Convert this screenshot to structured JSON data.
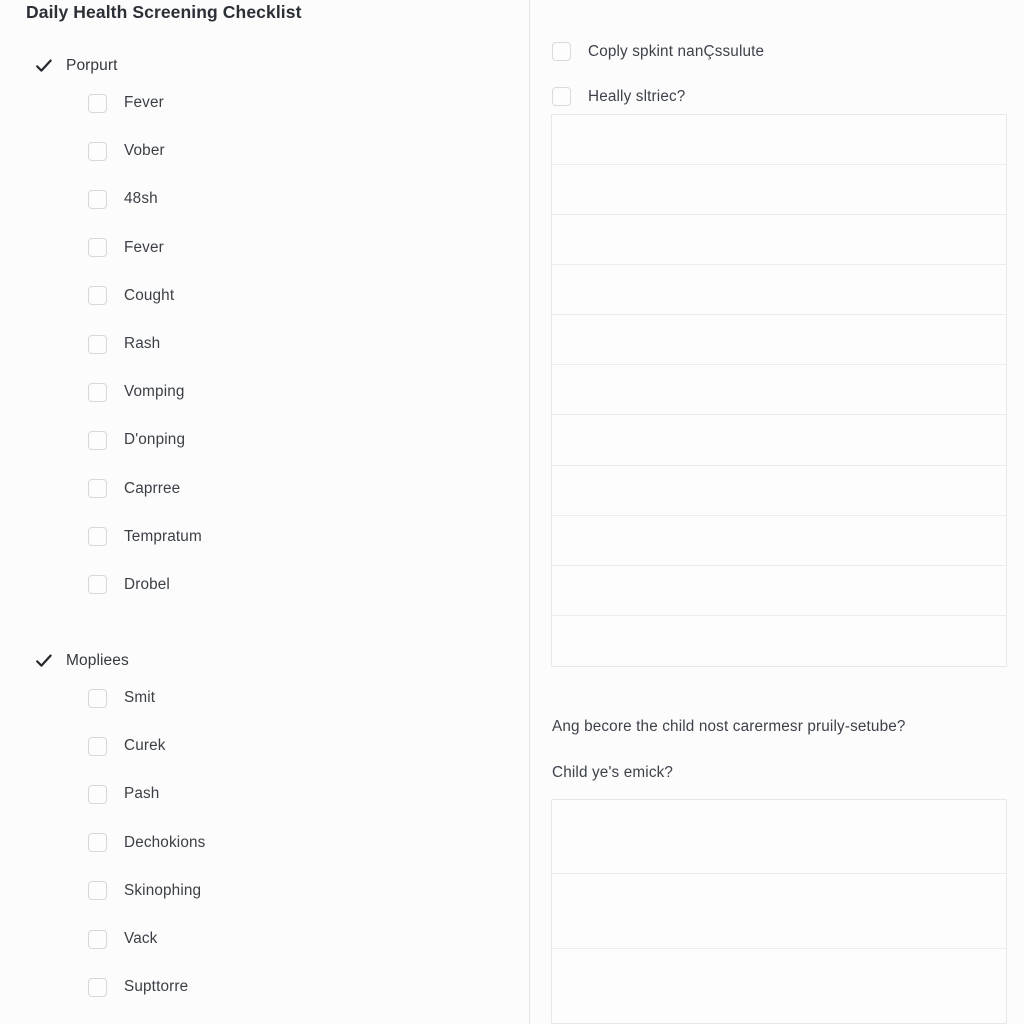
{
  "page": {
    "title": "Daily Health Screening Checklist",
    "background_color": "#fcfcfc",
    "text_color": "#3a3f46",
    "divider_color": "#e3e4e6"
  },
  "left_panel": {
    "groups": [
      {
        "label": "Porpurt",
        "checked": true,
        "check_icon": "checkmark-icon",
        "items": [
          {
            "label": "Fever",
            "checked": false
          },
          {
            "label": "Vober",
            "checked": false
          },
          {
            "label": "48sh",
            "checked": false
          },
          {
            "label": "Fever",
            "checked": false
          },
          {
            "label": "Cought",
            "checked": false
          },
          {
            "label": "Rash",
            "checked": false
          },
          {
            "label": "Vomping",
            "checked": false
          },
          {
            "label": "D'onping",
            "checked": false
          },
          {
            "label": "Caprree",
            "checked": false
          },
          {
            "label": "Tempratum",
            "checked": false
          },
          {
            "label": "Drobel",
            "checked": false
          }
        ]
      },
      {
        "label": "Mopliees",
        "checked": true,
        "check_icon": "checkmark-icon",
        "items": [
          {
            "label": "Smit",
            "checked": false
          },
          {
            "label": "Curek",
            "checked": false
          },
          {
            "label": "Pash",
            "checked": false
          },
          {
            "label": "Dechokions",
            "checked": false
          },
          {
            "label": "Skinophing",
            "checked": false
          },
          {
            "label": "Vack",
            "checked": false
          },
          {
            "label": "Supttorre",
            "checked": false
          }
        ]
      }
    ]
  },
  "right_panel": {
    "questions": [
      {
        "label": "Coply spkint nanÇssulute",
        "checked": false
      },
      {
        "label": "Heally sltriec?",
        "checked": false
      }
    ],
    "top_grid": {
      "rows": 11,
      "row_labels": [
        "",
        "",
        "",
        "",
        "",
        "",
        "",
        "",
        "",
        "",
        ""
      ]
    },
    "paragraphs": [
      "Ang becore the child nost carermesr pruily-setube?",
      "Child ye's emick?"
    ],
    "bottom_grid": {
      "rows": 3,
      "row_labels": [
        "",
        "",
        ""
      ]
    }
  }
}
